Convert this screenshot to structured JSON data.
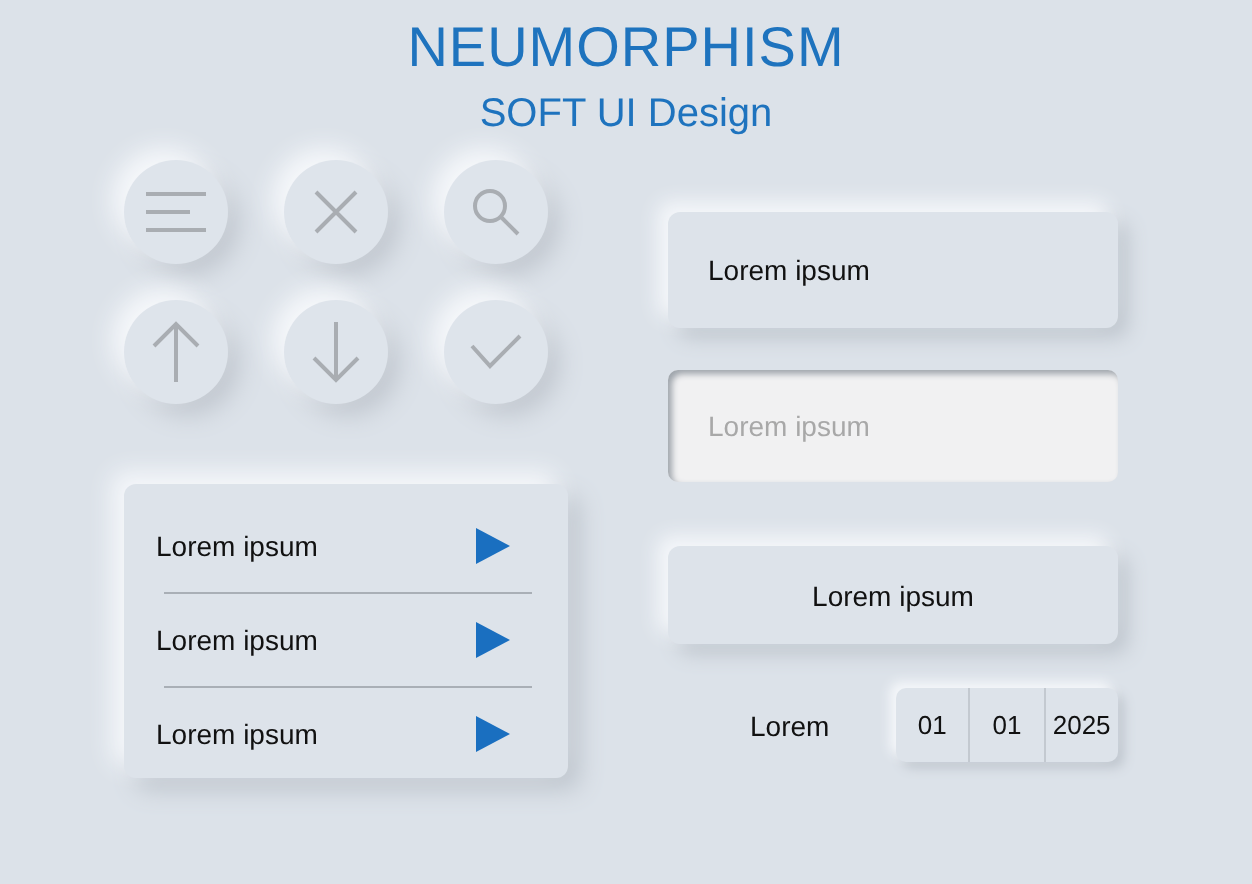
{
  "title": "NEUMORPHISM",
  "subtitle": "SOFT UI Design",
  "icon_buttons": [
    {
      "kind": "menu"
    },
    {
      "kind": "close"
    },
    {
      "kind": "search"
    },
    {
      "kind": "up"
    },
    {
      "kind": "down"
    },
    {
      "kind": "check"
    }
  ],
  "list": [
    {
      "label": "Lorem ipsum"
    },
    {
      "label": "Lorem ipsum"
    },
    {
      "label": "Lorem ipsum"
    }
  ],
  "raised_field": {
    "value": "Lorem ipsum"
  },
  "input_field": {
    "placeholder": "Lorem ipsum"
  },
  "button": {
    "label": "Lorem ipsum"
  },
  "date": {
    "label": "Lorem",
    "day": "01",
    "month": "01",
    "year": "2025"
  }
}
